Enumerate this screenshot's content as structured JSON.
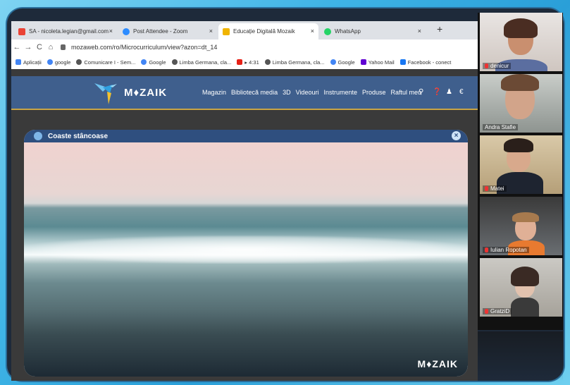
{
  "browser": {
    "tabs": [
      {
        "label": "SA - nicoleta.legian@gmail.com",
        "favicon_color": "#ea4335",
        "close": "×"
      },
      {
        "label": "Post Attendee - Zoom",
        "favicon_color": "#2d8cff",
        "close": "×"
      },
      {
        "label": "Educație Digitală Mozaik",
        "favicon_color": "#f0b400",
        "close": "×",
        "active": true
      },
      {
        "label": "WhatsApp",
        "favicon_color": "#25d366",
        "close": "×"
      }
    ],
    "new_tab": "+",
    "back": "←",
    "forward": "→",
    "reload": "C",
    "home": "⌂",
    "url": "mozaweb.com/ro/Microcurriculum/view?azon=dt_14",
    "bookmarks": [
      {
        "label": "Aplicații",
        "color": "#4285f4"
      },
      {
        "label": "google",
        "color": "#4285f4"
      },
      {
        "label": "Comunicare I - Sem...",
        "color": "#555555"
      },
      {
        "label": "Google",
        "color": "#4285f4"
      },
      {
        "label": "Limba Germana, cla...",
        "color": "#555555"
      },
      {
        "label": "▸ 4:31",
        "color": "#e62117"
      },
      {
        "label": "Limba Germana, cla...",
        "color": "#555555"
      },
      {
        "label": "Google",
        "color": "#4285f4"
      },
      {
        "label": "Yahoo Mail",
        "color": "#6001d2"
      },
      {
        "label": "Facebook - conect",
        "color": "#1877f2"
      }
    ]
  },
  "site": {
    "logo_text": "M♦ZAIK",
    "menu": [
      "Magazin",
      "Bibliotecă media",
      "3D",
      "Videouri",
      "Instrumente",
      "Produse",
      "Raftul meu"
    ],
    "icons": [
      "search-icon",
      "help-icon",
      "user-icon",
      "cart-icon"
    ],
    "panel": {
      "title": "Coaste stâncoase",
      "close": "×",
      "watermark": "M♦ZAIK"
    }
  },
  "participants": [
    {
      "name": "denicur"
    },
    {
      "name": "Andra Stafie"
    },
    {
      "name": "Matei"
    },
    {
      "name": "Iulian Ropotan"
    },
    {
      "name": "GratziD"
    }
  ]
}
